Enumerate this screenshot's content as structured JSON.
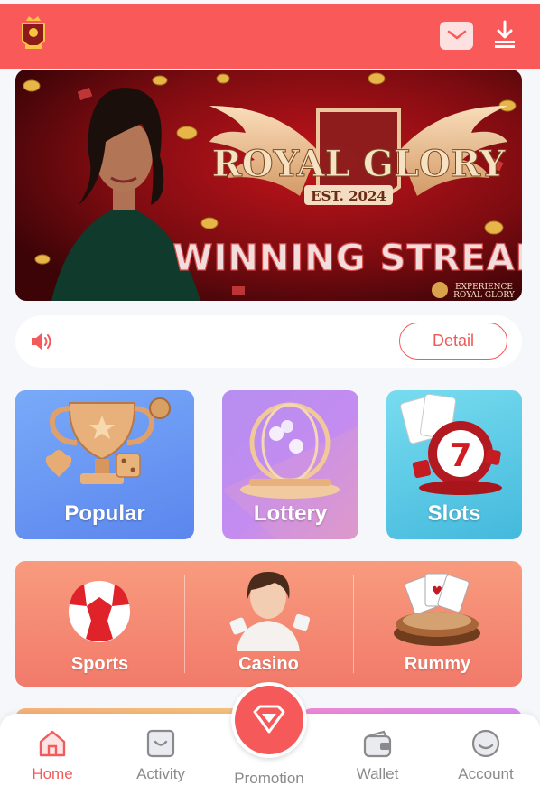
{
  "header": {
    "logo_icon": "crown-shield-logo-icon",
    "message_icon": "envelope-icon",
    "download_icon": "download-icon"
  },
  "banner": {
    "brand_line1": "ROYAL GLORY",
    "est": "EST. 2024",
    "headline": "WINNING STREAK",
    "badge_top": "EXPERIENCE",
    "badge_bottom": "ROYAL GLORY"
  },
  "notice": {
    "icon": "speaker-icon",
    "detail_label": "Detail"
  },
  "categories": [
    {
      "label": "Popular",
      "icon": "trophy-icon"
    },
    {
      "label": "Lottery",
      "icon": "lottery-drum-icon"
    },
    {
      "label": "Slots",
      "icon": "slot-machine-icon"
    }
  ],
  "games": [
    {
      "label": "Sports",
      "icon": "soccer-ball-icon"
    },
    {
      "label": "Casino",
      "icon": "dealer-icon"
    },
    {
      "label": "Rummy",
      "icon": "playing-cards-icon"
    }
  ],
  "tabs": {
    "home": "Home",
    "activity": "Activity",
    "promotion": "Promotion",
    "wallet": "Wallet",
    "account": "Account",
    "active": "Home"
  },
  "colors": {
    "header": "#f95959",
    "accent": "#f25b5b",
    "inactive_tab": "#8a8a8a"
  }
}
